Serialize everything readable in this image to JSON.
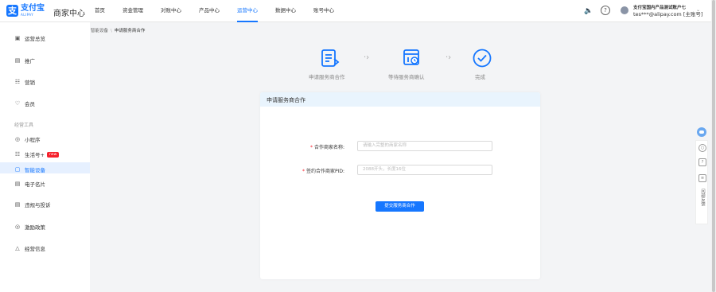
{
  "header": {
    "logo_cn": "支付宝",
    "logo_en": "ALIPAY",
    "merchant_center": "商家中心",
    "nav": [
      {
        "label": "首页"
      },
      {
        "label": "资金管理"
      },
      {
        "label": "对账中心"
      },
      {
        "label": "产品中心"
      },
      {
        "label": "运营中心"
      },
      {
        "label": "数据中心"
      },
      {
        "label": "账号中心"
      }
    ],
    "active_nav": "运营中心",
    "account_name": "支付宝国内产品测试账户七",
    "account_email": "tes***@alipay.com [主账号]"
  },
  "sidebar": {
    "items": [
      {
        "icon": "overview-icon",
        "label": "运营总览"
      },
      {
        "icon": "promo-icon",
        "label": "推广"
      },
      {
        "icon": "marketing-icon",
        "label": "营销"
      },
      {
        "icon": "member-icon",
        "label": "会员"
      }
    ],
    "group_title": "经营工具",
    "tools": [
      {
        "icon": "miniapp-icon",
        "label": "小程序"
      },
      {
        "icon": "lifeaccount-icon",
        "label": "生活号+",
        "badge": "new"
      },
      {
        "icon": "smartdevice-icon",
        "label": "智能设备",
        "active": true
      },
      {
        "icon": "ecard-icon",
        "label": "电子名片"
      }
    ],
    "bottom": [
      {
        "icon": "complaint-icon",
        "label": "违规与投诉"
      },
      {
        "icon": "incentive-icon",
        "label": "激励政策"
      },
      {
        "icon": "info-icon",
        "label": "经营信息"
      }
    ]
  },
  "breadcrumb": {
    "parent": "智能设备",
    "separator": "\\",
    "current": "申请服务商合作"
  },
  "steps": [
    {
      "label": "申请服务商合作"
    },
    {
      "label": "等待服务商确认"
    },
    {
      "label": "完成"
    }
  ],
  "form": {
    "title": "申请服务商合作",
    "fields": [
      {
        "label": "合作商家名称:",
        "placeholder": "请输入完整的商家名称"
      },
      {
        "label": "签约合作商家PID:",
        "placeholder": "2088开头，长度16位"
      }
    ],
    "submit_label": "提交服务商合作"
  },
  "float_bar": {
    "feedback": "问题反馈"
  },
  "colors": {
    "brand": "#1677ff",
    "required": "#f5222d",
    "card_head": "#e9f4fd"
  }
}
